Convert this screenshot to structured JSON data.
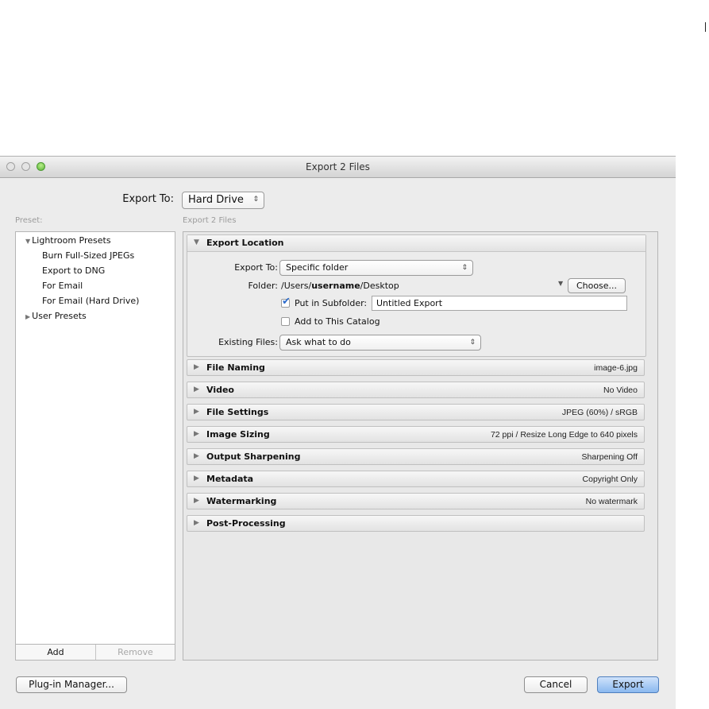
{
  "window": {
    "title": "Export 2 Files"
  },
  "export_to": {
    "label": "Export To:",
    "value": "Hard Drive"
  },
  "preset": {
    "header": "Preset:",
    "tree": [
      {
        "label": "Lightroom Presets",
        "expanded": true
      },
      {
        "label": "Burn Full-Sized JPEGs"
      },
      {
        "label": "Export to DNG"
      },
      {
        "label": "For Email"
      },
      {
        "label": "For Email (Hard Drive)"
      },
      {
        "label": "User Presets",
        "expanded": false
      }
    ],
    "add_label": "Add",
    "remove_label": "Remove"
  },
  "settings_header": "Export 2 Files",
  "export_location": {
    "title": "Export Location",
    "export_to_label": "Export To:",
    "export_to_value": "Specific folder",
    "folder_label": "Folder:",
    "folder_prefix": "/Users/",
    "folder_user": "username",
    "folder_suffix": "/Desktop",
    "choose_label": "Choose...",
    "subfolder_label": "Put in Subfolder:",
    "subfolder_checked": true,
    "subfolder_value": "Untitled Export",
    "add_catalog_label": "Add to This Catalog",
    "add_catalog_checked": false,
    "existing_label": "Existing Files:",
    "existing_value": "Ask what to do"
  },
  "sections": [
    {
      "title": "File Naming",
      "summary": "image-6.jpg"
    },
    {
      "title": "Video",
      "summary": "No Video"
    },
    {
      "title": "File Settings",
      "summary": "JPEG (60%) / sRGB"
    },
    {
      "title": "Image Sizing",
      "summary": "72 ppi / Resize Long Edge to 640 pixels"
    },
    {
      "title": "Output Sharpening",
      "summary": "Sharpening Off"
    },
    {
      "title": "Metadata",
      "summary": "Copyright Only"
    },
    {
      "title": "Watermarking",
      "summary": "No watermark"
    },
    {
      "title": "Post-Processing",
      "summary": ""
    }
  ],
  "buttons": {
    "plugin_manager": "Plug-in Manager...",
    "cancel": "Cancel",
    "export": "Export"
  },
  "icons": {
    "collapsed_triangle": "▶",
    "expanded_triangle": "▼",
    "popup_arrows": "⇕",
    "dropdown_arrow": "▼",
    "checkmark": "✔"
  }
}
